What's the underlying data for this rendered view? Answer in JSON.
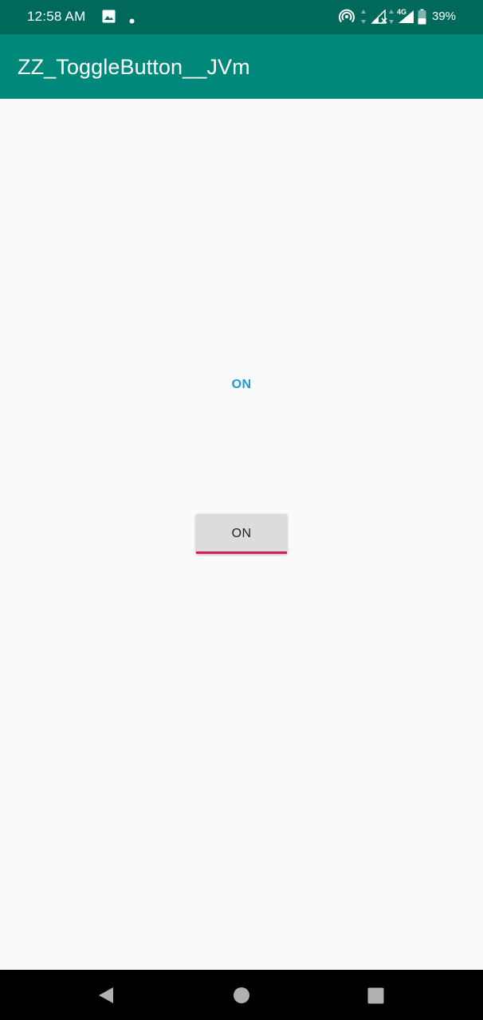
{
  "status_bar": {
    "time": "12:58 AM",
    "battery_percent": "39%",
    "network_type": "4G",
    "left_icons": [
      "image-icon",
      "notification-dot-icon"
    ],
    "right_icons": [
      "hotspot-icon",
      "data-arrows-icon",
      "signal-no-data-icon",
      "signal-4g-icon",
      "battery-icon"
    ]
  },
  "app_bar": {
    "title": "ZZ_ToggleButton__JVm",
    "color": "#00897b"
  },
  "main": {
    "state_text": "ON",
    "state_text_color": "#1e9bd0",
    "toggle": {
      "label": "ON",
      "checked": true,
      "indicator_color": "#d81b60"
    }
  },
  "nav_bar": {
    "buttons": [
      "back-icon",
      "home-icon",
      "recents-icon"
    ]
  }
}
